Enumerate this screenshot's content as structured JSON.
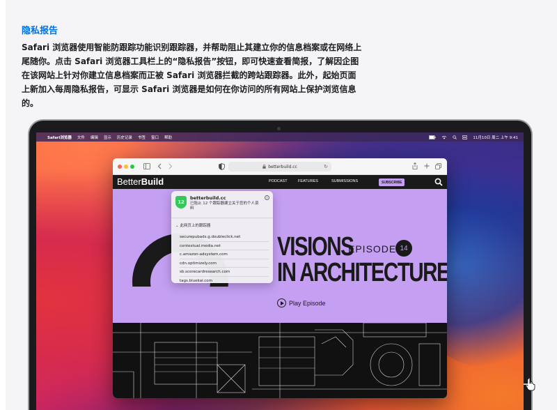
{
  "article": {
    "heading": "隐私报告",
    "paragraph": "Safari 浏览器使用智能防跟踪功能识别跟踪器，并帮助阻止其建立你的信息档案或在网络上尾随你。点击 Safari 浏览器工具栏上的“隐私报告”按钮，即可快速查看简报，了解因企图在该网站上针对你建立信息档案而正被 Safari 浏览器拦截的跨站跟踪器。此外，起始页面上新加入每周隐私报告，可显示 Safari 浏览器是如何在你访问的所有网站上保护浏览信息的。"
  },
  "menubar": {
    "apple_glyph": "",
    "app_name": "Safari浏览器",
    "items": [
      "文件",
      "编辑",
      "显示",
      "历史记录",
      "书签",
      "窗口",
      "帮助"
    ],
    "datetime": "11月10日 周二 上午 9:41"
  },
  "browser": {
    "url": "betterbuild.cc",
    "traffic_colors": [
      "#ff5f57",
      "#febc2e",
      "#28c840"
    ]
  },
  "site": {
    "logo_light": "Better",
    "logo_bold": "Build",
    "nav": [
      "PODCAST",
      "FEATURES",
      "SUBMISSIONS"
    ],
    "subscribe": "SUBSCRIBE",
    "hero_line1": "VISIONS",
    "hero_line2": "IN ARCHITECTURE",
    "episode_label": "EPISODE",
    "episode_number": "14",
    "play_label": "Play Episode",
    "accent_color": "#c49ff2"
  },
  "privacy_popover": {
    "count": "12",
    "site": "betterbuild.cc",
    "message": "已阻止 12 个跟踪器建立关于您的个人资料",
    "section_title": "此网页上的跟踪器",
    "trackers": [
      "securepubads.g.doubleclick.net",
      "contextual.media.net",
      "c.amazon-adsystem.com",
      "cdn.optimizely.com",
      "sb.scorecardresearch.com",
      "tags.bluekai.com"
    ]
  }
}
